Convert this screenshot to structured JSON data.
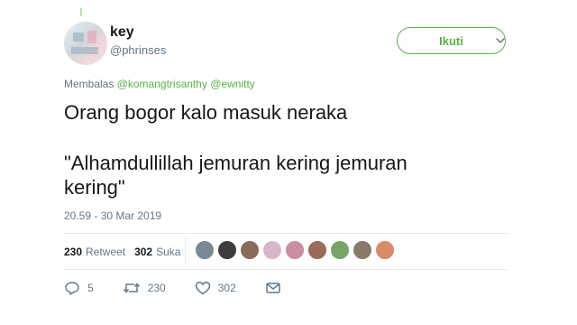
{
  "author": {
    "name": "key",
    "handle": "@phrinses"
  },
  "follow_label": "Ikuti",
  "reply_to": {
    "prefix": "Membalas",
    "mention1": "@komangtrisanthy",
    "mention2": "@ewnitty"
  },
  "tweet": {
    "line1": "Orang bogor kalo masuk neraka",
    "line2": "\"Alhamdullillah jemuran kering jemuran",
    "line3": "kering\""
  },
  "timestamp": "20.59 - 30 Mar 2019",
  "stats": {
    "retweets_count": "230",
    "retweets_label": "Retweet",
    "likes_count": "302",
    "likes_label": "Suka"
  },
  "likers": [
    "#7a8a94",
    "#3d3d3d",
    "#8a6a5a",
    "#d6b6c8",
    "#c98ea0",
    "#9a6a5a",
    "#7aa36a",
    "#8a7a6a",
    "#d98a6a"
  ],
  "actions": {
    "reply_count": "5",
    "retweet_count": "230",
    "like_count": "302"
  },
  "colors": {
    "accent": "#59b345",
    "text": "#14171a",
    "muted": "#657786"
  }
}
